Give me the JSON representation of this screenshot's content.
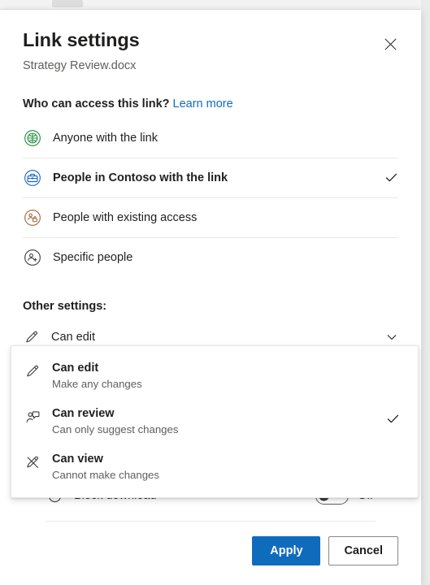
{
  "dialog": {
    "title": "Link settings",
    "file_name": "Strategy Review.docx",
    "close_label": "Close"
  },
  "access_section": {
    "heading": "Who can access this link?",
    "learn_more": "Learn more",
    "options": [
      {
        "label": "Anyone with the link",
        "icon": "globe-icon",
        "icon_color": "#1f8a3b",
        "selected": false
      },
      {
        "label": "People in Contoso with the link",
        "icon": "briefcase-icon",
        "icon_color": "#1565c0",
        "selected": true
      },
      {
        "label": "People with existing access",
        "icon": "people-lock-icon",
        "icon_color": "#a4633a",
        "selected": false
      },
      {
        "label": "Specific people",
        "icon": "people-add-icon",
        "icon_color": "#3b3a39",
        "selected": false
      }
    ]
  },
  "other_settings": {
    "heading": "Other settings:",
    "permission": {
      "icon": "pencil-icon",
      "value": "Can edit",
      "chevron": "chevron-down-icon",
      "expanded": true,
      "options": [
        {
          "title": "Can edit",
          "description": "Make any changes",
          "icon": "pencil-icon",
          "selected": false
        },
        {
          "title": "Can review",
          "description": "Can only suggest changes",
          "icon": "person-comment-icon",
          "selected": true
        },
        {
          "title": "Can view",
          "description": "Cannot make changes",
          "icon": "pencil-off-icon",
          "selected": false
        }
      ]
    },
    "block_download": {
      "icon": "block-icon",
      "label": "Block download",
      "state": "Off",
      "enabled": false
    }
  },
  "footer": {
    "apply_label": "Apply",
    "cancel_label": "Cancel"
  },
  "colors": {
    "accent": "#0f6cbd",
    "link": "#0f6cbd",
    "text_primary": "#201f1e",
    "text_secondary": "#605e5c",
    "divider": "#ebe9e7"
  }
}
